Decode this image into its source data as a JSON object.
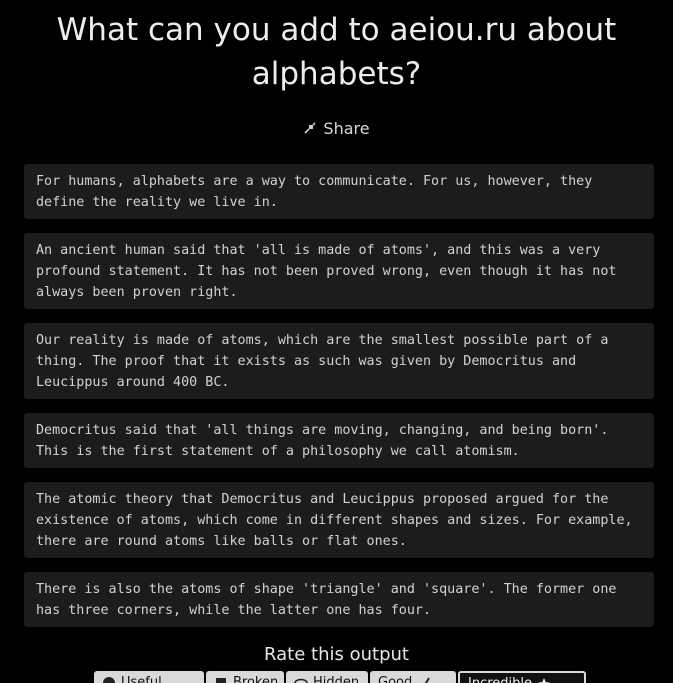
{
  "page": {
    "title": "What can you add to aeiou.ru about alphabets?",
    "share_label": "Share"
  },
  "paragraphs": [
    "For humans, alphabets are a way to communicate. For us, however, they define the reality we live in.",
    "An ancient human said that 'all is made of atoms', and this was a very profound statement. It has not been proved wrong, even though it has not always been proven right.",
    "Our reality is made of atoms, which are the smallest possible part of a thing. The proof that it exists as such was given by Democritus and Leucippus around 400 BC.",
    "Democritus said that 'all things are moving, changing, and being born'. This is the first statement of a philosophy we call atomism.",
    "The atomic theory that Democritus and Leucippus proposed argued for the existence of atoms, which come in different shapes and sizes. For example, there are round atoms like balls or flat ones.",
    "There is also the atoms of shape 'triangle' and 'square'. The former one has three corners, while the latter one has four."
  ],
  "rating": {
    "title": "Rate this output",
    "buttons": [
      {
        "label": "Useful",
        "icon": "heart-icon"
      },
      {
        "label": "Broken",
        "icon": "document-icon"
      },
      {
        "label": "Hidden",
        "icon": "eye-icon"
      },
      {
        "label": "Good",
        "icon": "check-icon"
      },
      {
        "label": "Incredible",
        "icon": "star-icon"
      }
    ]
  },
  "colors": {
    "background": "#000000",
    "card_background": "#1c1c1c",
    "text": "#d2d2d2",
    "button_light": "#d9d9d9"
  }
}
